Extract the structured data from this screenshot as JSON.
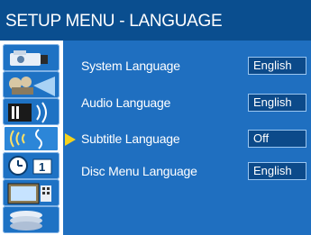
{
  "header": {
    "title": "SETUP MENU - LANGUAGE"
  },
  "sidebar": {
    "icons": [
      {
        "name": "camera-icon"
      },
      {
        "name": "projector-icon"
      },
      {
        "name": "speaker-icon"
      },
      {
        "name": "subtitle-wave-icon"
      },
      {
        "name": "clock-timer-icon"
      },
      {
        "name": "tv-screen-icon"
      },
      {
        "name": "disc-stack-icon"
      }
    ],
    "active_index": 3
  },
  "menu": {
    "items": [
      {
        "label": "System Language",
        "value": "English"
      },
      {
        "label": "Audio Language",
        "value": "English"
      },
      {
        "label": "Subtitle Language",
        "value": "Off"
      },
      {
        "label": "Disc Menu Language",
        "value": "English"
      }
    ],
    "selected_index": 2
  },
  "colors": {
    "title_bg": "#0a4e8f",
    "panel_bg": "#1f6fc0",
    "value_bg": "#0c4a8a",
    "pointer": "#f5d21c"
  }
}
